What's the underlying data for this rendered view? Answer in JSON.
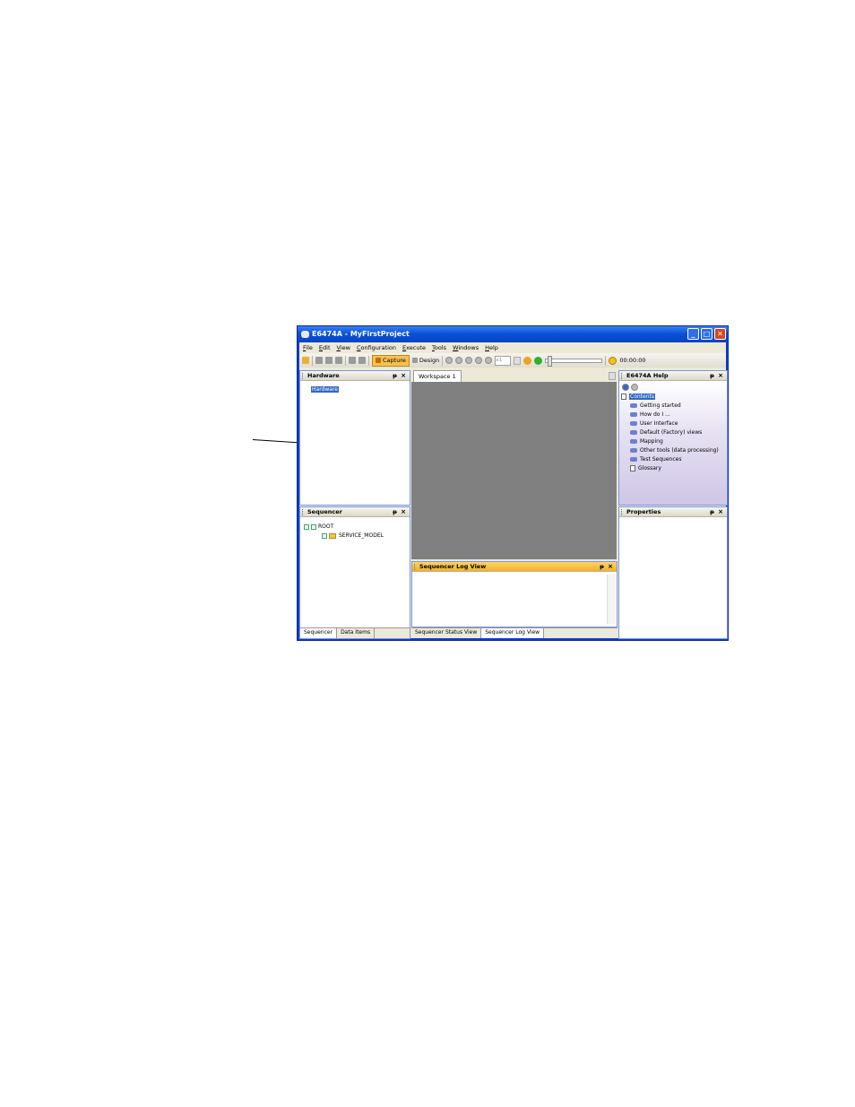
{
  "window": {
    "title": "E6474A - MyFirstProject",
    "buttons": {
      "minimize": "_",
      "maximize": "□",
      "close": "✕"
    }
  },
  "menu": [
    "File",
    "Edit",
    "View",
    "Configuration",
    "Execute",
    "Tools",
    "Windows",
    "Help"
  ],
  "toolbar": {
    "capture_label": "Capture",
    "design_label": "Design",
    "speed_value": "x1",
    "time": "00:00:00"
  },
  "panels": {
    "hardware": {
      "title": "Hardware",
      "tree_root": "Hardware"
    },
    "workspace": {
      "tab": "Workspace 1"
    },
    "help": {
      "title": "E6474A Help",
      "contents_label": "Contents",
      "items": [
        "Getting started",
        "How do I ...",
        "User Interface",
        "Default (Factory) views",
        "Mapping",
        "Other tools (data processing)",
        "Test Sequences",
        "Glossary"
      ]
    },
    "sequencer": {
      "title": "Sequencer",
      "root": "ROOT",
      "child": "SERVICE_MODEL"
    },
    "log": {
      "title": "Sequencer Log View"
    },
    "properties": {
      "title": "Properties"
    }
  },
  "tabs": {
    "left": [
      "Sequencer",
      "Data Items"
    ],
    "bottom": [
      "Sequencer Status View",
      "Sequencer Log View"
    ]
  },
  "panel_controls": {
    "pin": "ᵽ",
    "close": "×"
  }
}
